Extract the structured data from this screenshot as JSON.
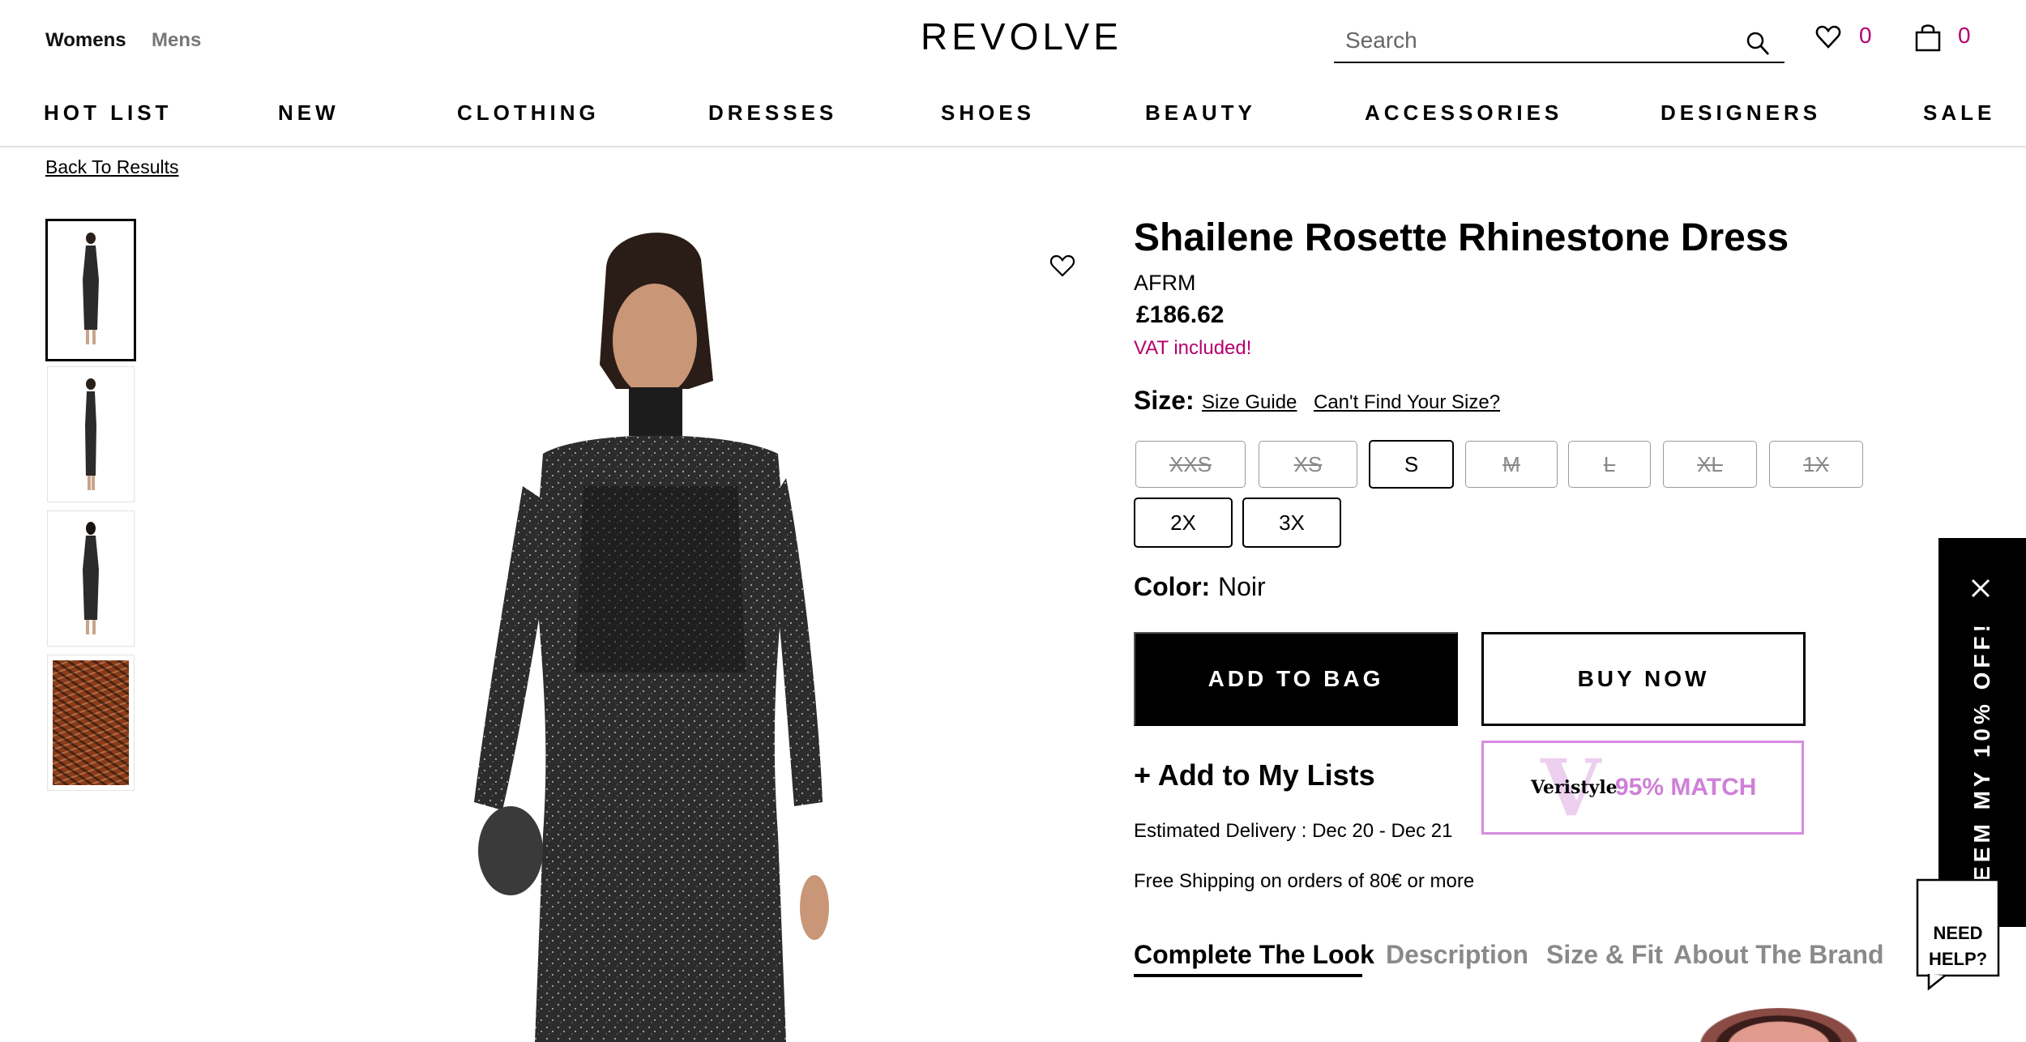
{
  "header": {
    "gender_tabs": [
      {
        "label": "Womens",
        "active": true
      },
      {
        "label": "Mens",
        "active": false
      }
    ],
    "logo": "REVOLVE",
    "search": {
      "placeholder": "Search",
      "value": ""
    },
    "wishlist_count": "0",
    "bag_count": "0"
  },
  "nav": {
    "items": [
      "HOT LIST",
      "NEW",
      "CLOTHING",
      "DRESSES",
      "SHOES",
      "BEAUTY",
      "ACCESSORIES",
      "DESIGNERS",
      "SALE"
    ]
  },
  "breadcrumb": {
    "back_label": "Back To Results"
  },
  "gallery": {
    "thumbnails": [
      "front-view",
      "side-view",
      "back-view",
      "fabric-detail"
    ],
    "active_index": 0
  },
  "product": {
    "title": "Shailene Rosette Rhinestone Dress",
    "brand": "AFRM",
    "price": "£186.62",
    "vat_note": "VAT included!",
    "size_label": "Size:",
    "size_guide": "Size Guide",
    "cant_find_size": "Can't Find Your Size?",
    "sizes": [
      {
        "label": "XXS",
        "available": false
      },
      {
        "label": "XS",
        "available": false
      },
      {
        "label": "S",
        "available": true
      },
      {
        "label": "M",
        "available": false
      },
      {
        "label": "L",
        "available": false
      },
      {
        "label": "XL",
        "available": false
      },
      {
        "label": "1X",
        "available": false
      },
      {
        "label": "2X",
        "available": true
      },
      {
        "label": "3X",
        "available": true
      }
    ],
    "color_label": "Color:",
    "color_value": "Noir",
    "add_to_bag": "ADD TO BAG",
    "buy_now": "BUY NOW",
    "add_to_lists": "+ Add to My Lists",
    "veristyle": {
      "brand": "Veristyle",
      "mark": "V",
      "match": "95% MATCH",
      "color": "#cf80d8"
    },
    "delivery": "Estimated Delivery : Dec 20 - Dec 21",
    "shipping": "Free Shipping on orders of 80€ or more"
  },
  "tabs": [
    {
      "label": "Complete The Look",
      "active": true
    },
    {
      "label": "Description",
      "active": false
    },
    {
      "label": "Size & Fit",
      "active": false
    },
    {
      "label": "About The Brand",
      "active": false
    }
  ],
  "promo": {
    "text": "REDEEM MY 10% OFF!"
  },
  "help": {
    "line1": "NEED",
    "line2": "HELP?"
  },
  "colors": {
    "accent": "#b5006e",
    "text": "#000000",
    "muted": "#8a8a8a",
    "veristyle_border": "#d88ce0"
  }
}
